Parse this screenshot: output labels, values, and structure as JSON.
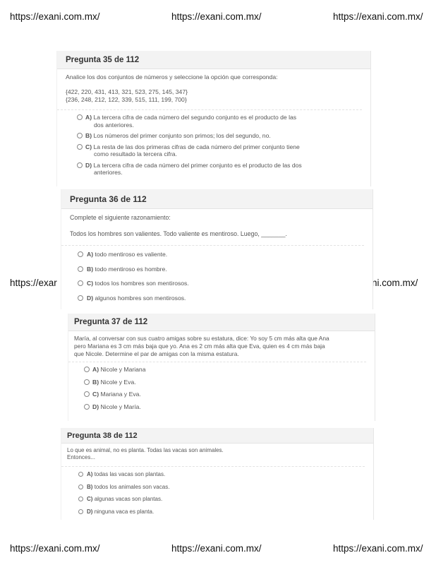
{
  "watermark": {
    "text_left": "https://exani.com.mx/",
    "text_center": "https://exani.com.mx/",
    "text_right": "https://exani.com.mx/",
    "middle_left_partial": "https://exar",
    "middle_right_partial": "ni.com.mx/"
  },
  "questions": [
    {
      "title": "Pregunta 35 de 112",
      "prompt": "Analice los dos conjuntos de números y seleccione la opción que corresponda:",
      "sets": [
        "{422, 220, 431, 413, 321, 523, 275, 145, 347}",
        "{236, 248, 212, 122, 339, 515, 111, 199, 700}"
      ],
      "options": [
        {
          "letter": "A)",
          "text": "La tercera cifra de cada número del segundo conjunto es el producto de las",
          "text2": "dos anteriores."
        },
        {
          "letter": "B)",
          "text": "Los números del primer conjunto son primos; los del segundo, no.",
          "text2": ""
        },
        {
          "letter": "C)",
          "text": "La resta de las dos primeras cifras de cada número del primer conjunto tiene",
          "text2": "como resultado la tercera cifra."
        },
        {
          "letter": "D)",
          "text": "La tercera cifra de cada número del primer conjunto es el producto de las dos",
          "text2": "anteriores."
        }
      ]
    },
    {
      "title": "Pregunta 36 de 112",
      "prompt": "Complete el siguiente razonamiento:",
      "prompt2": "Todos los hombres son valientes. Todo valiente es mentiroso. Luego, _______.",
      "options": [
        {
          "letter": "A)",
          "text": "todo mentiroso es valiente."
        },
        {
          "letter": "B)",
          "text": "todo mentiroso es hombre."
        },
        {
          "letter": "C)",
          "text": "todos los hombres son mentirosos."
        },
        {
          "letter": "D)",
          "text": "algunos hombres son mentirosos."
        }
      ]
    },
    {
      "title": "Pregunta 37 de 112",
      "prompt_lines": [
        "María, al conversar con sus cuatro amigas sobre su estatura, dice: Yo soy 5 cm más alta que Ana",
        "pero Mariana es 3 cm más baja que yo. Ana es 2 cm más alta que Eva, quien es 4 cm más baja",
        "que Nicole. Determine el par de amigas con la misma estatura."
      ],
      "options": [
        {
          "letter": "A)",
          "text": "Nicole y Mariana"
        },
        {
          "letter": "B)",
          "text": "Nicole y Eva."
        },
        {
          "letter": "C)",
          "text": "Mariana y Eva."
        },
        {
          "letter": "D)",
          "text": "Nicole y María."
        }
      ]
    },
    {
      "title": "Pregunta 38 de 112",
      "prompt_lines": [
        "Lo que es animal, no es planta. Todas las vacas son animales.",
        "Entonces..."
      ],
      "options": [
        {
          "letter": "A)",
          "text": "todas las vacas son plantas."
        },
        {
          "letter": "B)",
          "text": "todos los animales son vacas."
        },
        {
          "letter": "C)",
          "text": "algunas vacas son plantas."
        },
        {
          "letter": "D)",
          "text": "ninguna vaca es planta."
        }
      ]
    }
  ]
}
